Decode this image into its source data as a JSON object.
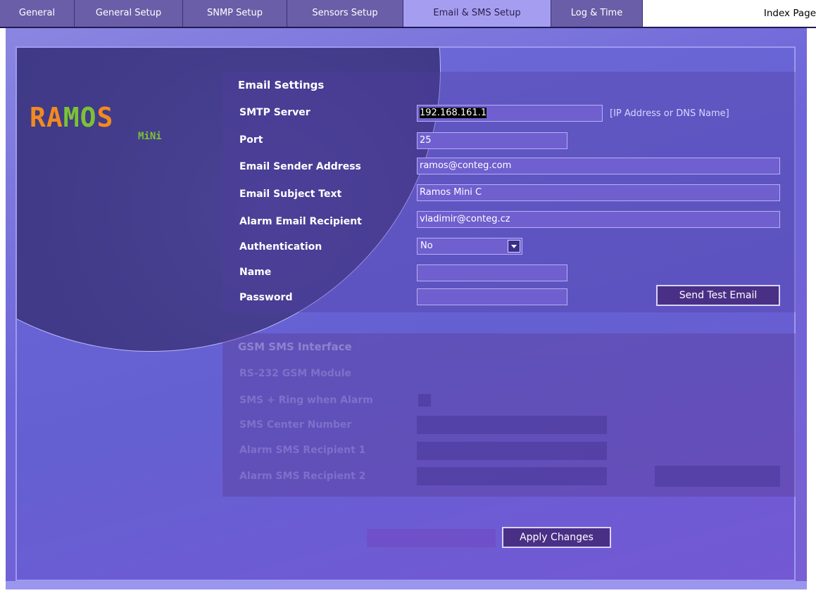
{
  "tabs": [
    {
      "label": "General",
      "active": false
    },
    {
      "label": "General Setup",
      "active": false
    },
    {
      "label": "SNMP Setup",
      "active": false
    },
    {
      "label": "Sensors Setup",
      "active": false
    },
    {
      "label": "Email & SMS Setup",
      "active": true
    },
    {
      "label": "Log & Time",
      "active": false
    }
  ],
  "index_link": "Index Page",
  "logo": {
    "main": "RAMOS",
    "sub": "MiNi"
  },
  "email": {
    "title": "Email Settings",
    "smtp_server": {
      "label": "SMTP Server",
      "value": "192.168.161.1",
      "hint": "[IP Address or  DNS Name]"
    },
    "port": {
      "label": "Port",
      "value": "25"
    },
    "sender": {
      "label": "Email Sender Address",
      "value": "ramos@conteg.com"
    },
    "subject": {
      "label": "Email Subject Text",
      "value": "Ramos Mini C"
    },
    "recipient": {
      "label": "Alarm Email Recipient",
      "value": "vladimir@conteg.cz"
    },
    "authentication": {
      "label": "Authentication",
      "value": "No"
    },
    "name": {
      "label": "Name",
      "value": ""
    },
    "password": {
      "label": "Password",
      "value": ""
    },
    "test_button": "Send Test Email"
  },
  "gsm": {
    "title": "GSM SMS Interface",
    "module": "RS-232 GSM Module",
    "ring_label": "SMS + Ring when Alarm",
    "center_label": "SMS Center Number",
    "recipient1_label": "Alarm SMS Recipient 1",
    "recipient2_label": "Alarm SMS Recipient 2"
  },
  "apply_button": "Apply Changes",
  "colors": {
    "tab": "#6a5ea8",
    "tab_active": "#a59ef0",
    "panel": "#6e6ad8",
    "button": "#4a2f86",
    "logo_orange": "#f28a1e",
    "logo_green": "#7cc234"
  }
}
